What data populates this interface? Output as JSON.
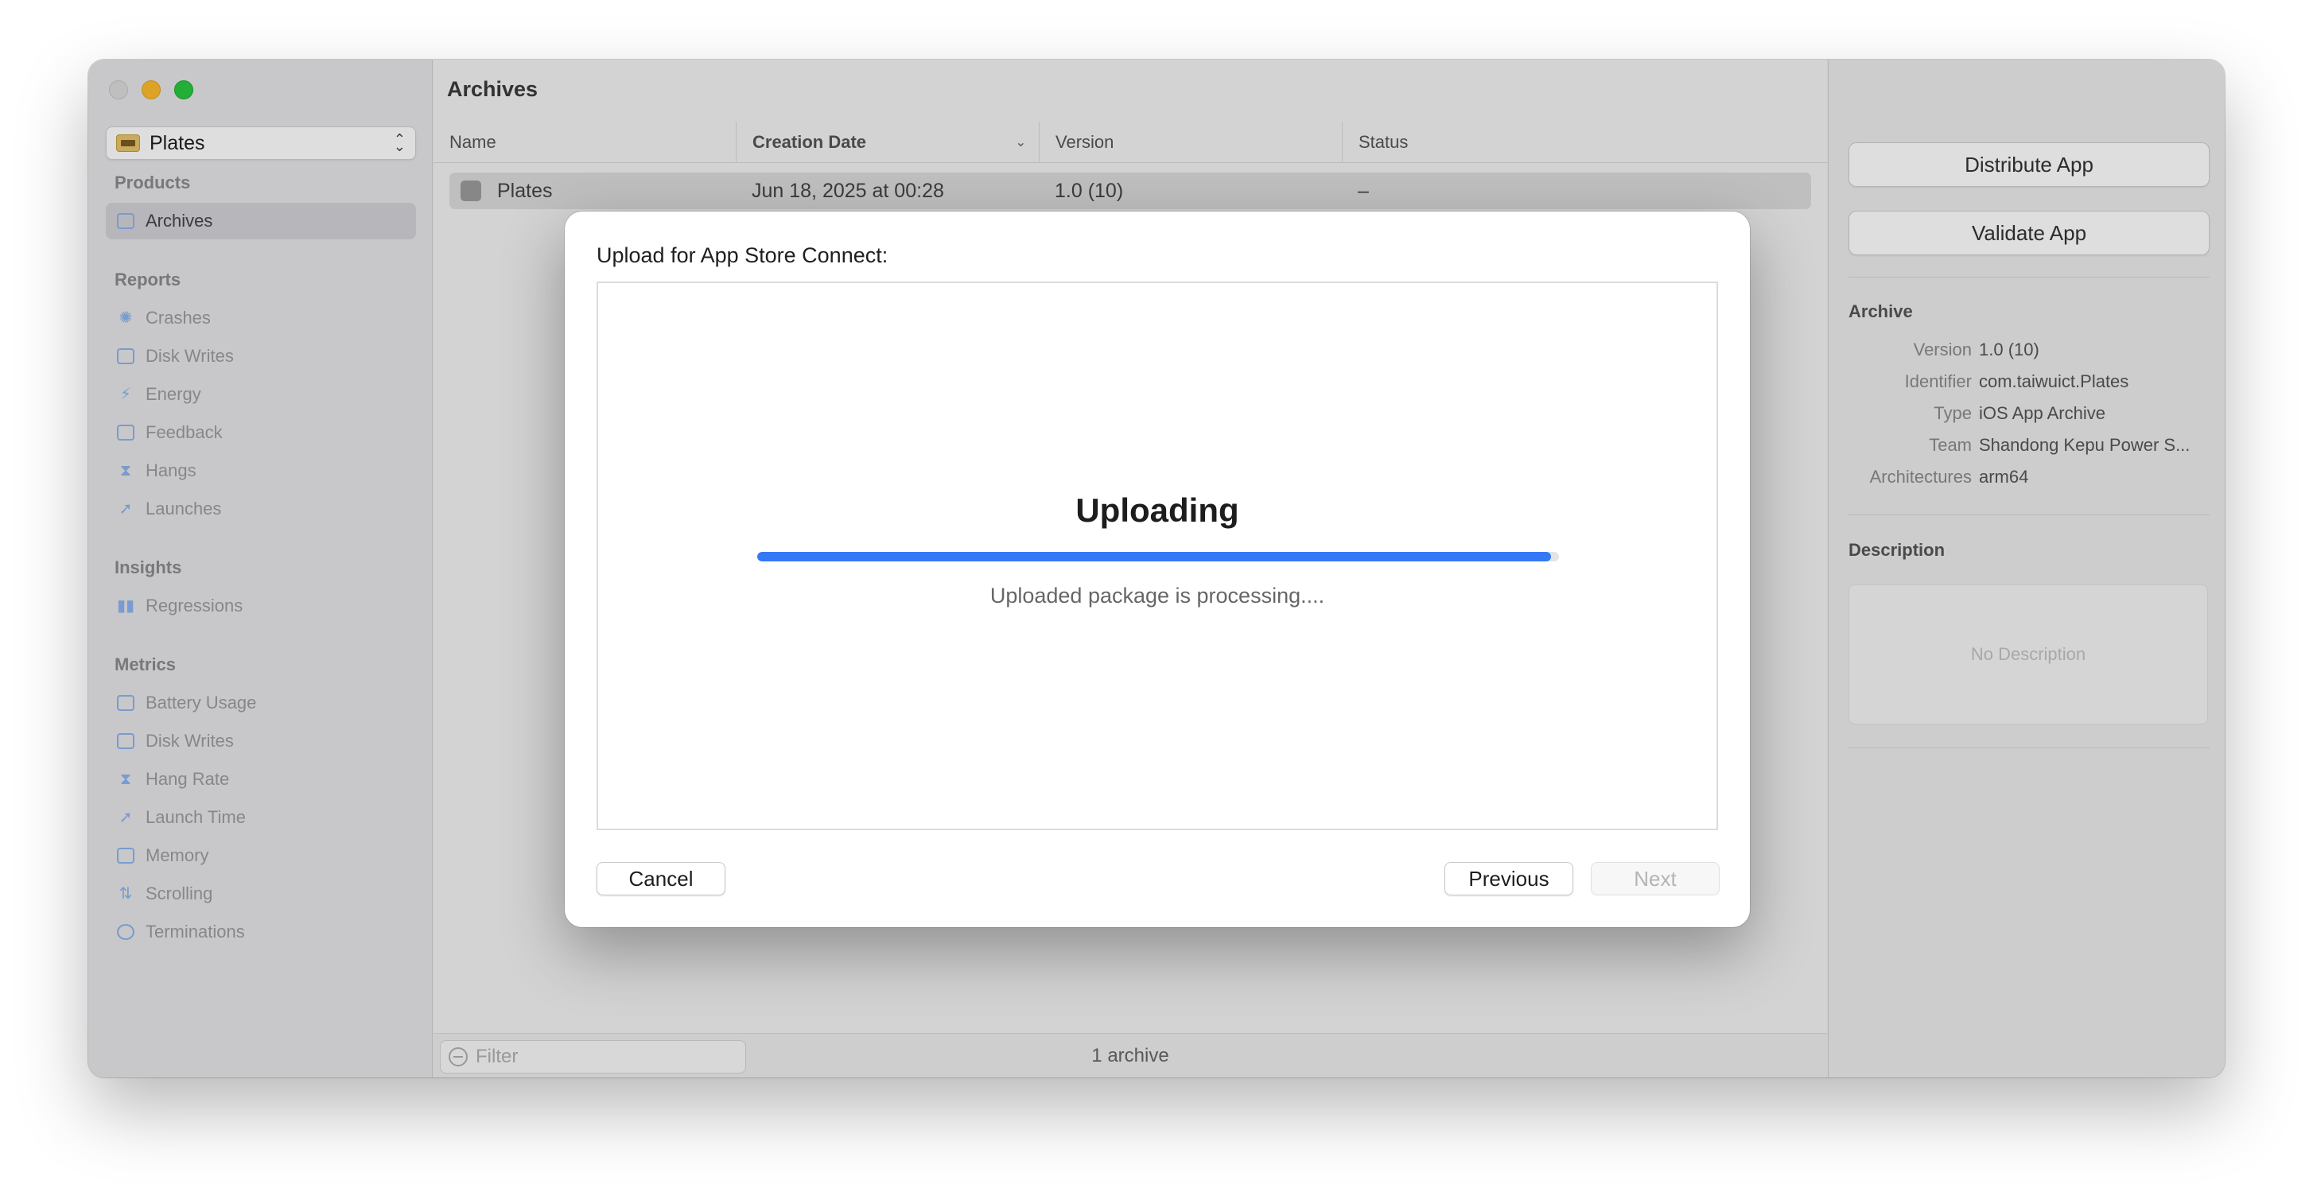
{
  "sidebar": {
    "app_name": "Plates",
    "sections": {
      "products": "Products",
      "reports": "Reports",
      "insights": "Insights",
      "metrics": "Metrics"
    },
    "products_items": [
      "Archives"
    ],
    "reports_items": [
      "Crashes",
      "Disk Writes",
      "Energy",
      "Feedback",
      "Hangs",
      "Launches"
    ],
    "insights_items": [
      "Regressions"
    ],
    "metrics_items": [
      "Battery Usage",
      "Disk Writes",
      "Hang Rate",
      "Launch Time",
      "Memory",
      "Scrolling",
      "Terminations"
    ]
  },
  "center": {
    "title": "Archives",
    "columns": {
      "name": "Name",
      "creation_date": "Creation Date",
      "version": "Version",
      "status": "Status"
    },
    "row": {
      "name": "Plates",
      "creation_date": "Jun 18, 2025 at 00:28",
      "version": "1.0 (10)",
      "status": "–"
    },
    "filter_placeholder": "Filter",
    "archive_count": "1 archive"
  },
  "inspector": {
    "distribute_label": "Distribute App",
    "validate_label": "Validate App",
    "archive_header": "Archive",
    "fields": {
      "version_key": "Version",
      "version_val": "1.0 (10)",
      "identifier_key": "Identifier",
      "identifier_val": "com.taiwuict.Plates",
      "type_key": "Type",
      "type_val": "iOS App Archive",
      "team_key": "Team",
      "team_val": "Shandong Kepu Power S...",
      "arch_key": "Architectures",
      "arch_val": "arm64"
    },
    "description_header": "Description",
    "description_placeholder": "No Description"
  },
  "sheet": {
    "title": "Upload for App Store Connect:",
    "heading": "Uploading",
    "status": "Uploaded package is processing....",
    "progress_fraction": 0.99,
    "cancel_label": "Cancel",
    "previous_label": "Previous",
    "next_label": "Next"
  }
}
